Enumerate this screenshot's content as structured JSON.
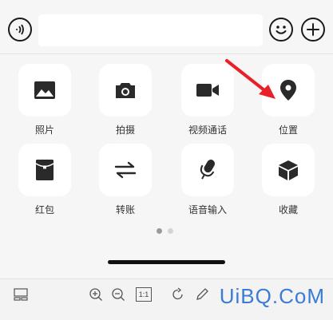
{
  "input_bar": {
    "text_value": "",
    "placeholder": ""
  },
  "actions": [
    {
      "id": "photos",
      "label": "照片",
      "icon": "image-icon"
    },
    {
      "id": "camera",
      "label": "拍摄",
      "icon": "camera-icon"
    },
    {
      "id": "video",
      "label": "视频通话",
      "icon": "video-camera-icon"
    },
    {
      "id": "location",
      "label": "位置",
      "icon": "location-pin-icon"
    },
    {
      "id": "red-packet",
      "label": "红包",
      "icon": "red-packet-icon"
    },
    {
      "id": "transfer",
      "label": "转账",
      "icon": "transfer-arrows-icon"
    },
    {
      "id": "voice-input",
      "label": "语音输入",
      "icon": "microphone-icon"
    },
    {
      "id": "favorites",
      "label": "收藏",
      "icon": "cube-icon"
    }
  ],
  "pager": {
    "pages": 2,
    "current": 1
  },
  "toolbar": {
    "zoom_label": "1:1"
  },
  "watermark": {
    "text": "UiBQ.CoM"
  },
  "colors": {
    "annotation": "#e8202a",
    "icon": "#1a1a1a",
    "watermark": "#3a7bd5"
  }
}
